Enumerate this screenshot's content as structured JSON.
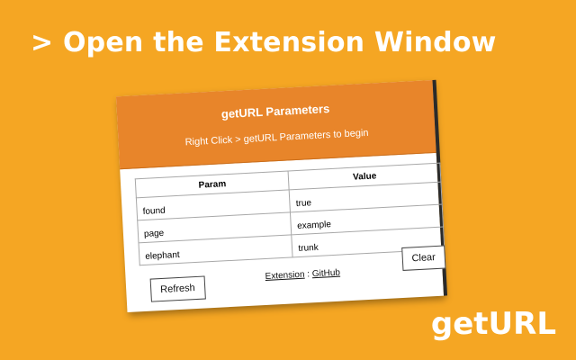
{
  "headline": "> Open the Extension Window",
  "brand": "getURL",
  "popup": {
    "title": "getURL Parameters",
    "subtitle": "Right Click > getURL Parameters to begin",
    "table": {
      "headers": [
        "Param",
        "Value"
      ],
      "rows": [
        {
          "param": "found",
          "value": "true"
        },
        {
          "param": "page",
          "value": "example"
        },
        {
          "param": "elephant",
          "value": "trunk"
        }
      ]
    },
    "refresh_label": "Refresh",
    "clear_label": "Clear",
    "links": {
      "extension": "Extension",
      "separator": ":",
      "github": "GitHub"
    }
  },
  "colors": {
    "background": "#f5a623",
    "header": "#e8852a",
    "text_light": "#ffffff"
  }
}
